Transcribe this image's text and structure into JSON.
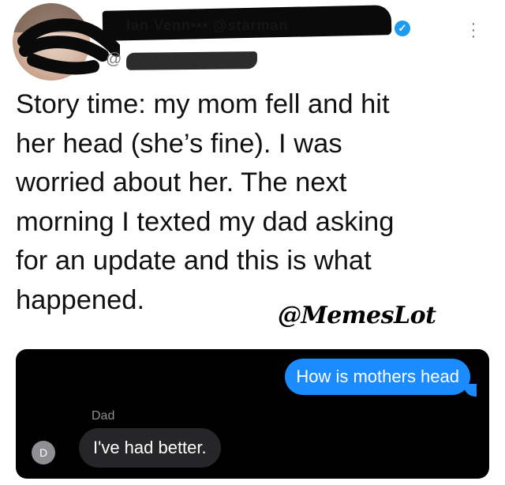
{
  "tweet": {
    "author_name": "Ian Venn••• @starman",
    "handle": "@",
    "text": "Story time: my mom fell and hit\nher head (she’s fine). I was\nworried about her. The next\nmorning I texted my dad asking\nfor an update and this is what\nhappened.",
    "watermark": "@MemesLot"
  },
  "messages": {
    "outgoing": "How is mothers head",
    "sender_name": "Dad",
    "sender_initial": "D",
    "incoming": "I've had better."
  },
  "colors": {
    "verified": "#1d9bf0",
    "imessage_blue": "#1a8cff",
    "incoming_bubble": "#262628",
    "panel_bg": "#000000"
  },
  "icons": {
    "verified": "verified-badge-icon",
    "more": "more-vertical-icon"
  }
}
